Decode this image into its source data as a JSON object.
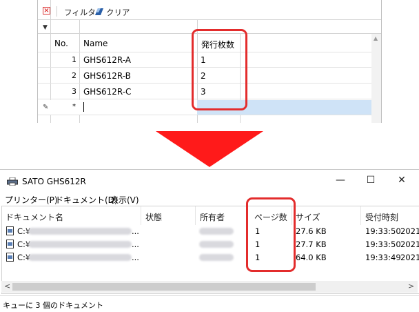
{
  "grid": {
    "toolbar": {
      "filter_label": "フィルタ",
      "clear_label": "クリア"
    },
    "columns": {
      "no": "No.",
      "name": "Name",
      "qty": "発行枚数"
    },
    "rows": [
      {
        "no": "1",
        "name": "GHS612R-A",
        "qty": "1"
      },
      {
        "no": "2",
        "name": "GHS612R-B",
        "qty": "2"
      },
      {
        "no": "3",
        "name": "GHS612R-C",
        "qty": "3"
      }
    ],
    "new_row_marker": "*"
  },
  "queue": {
    "title": "SATO GHS612R",
    "window_controls": {
      "minimize": "—",
      "maximize": "☐",
      "close": "✕"
    },
    "menu": [
      "プリンター(P)",
      "ドキュメント(D)",
      "表示(V)"
    ],
    "columns": {
      "doc": "ドキュメント名",
      "status": "状態",
      "owner": "所有者",
      "pages": "ページ数",
      "size": "サイズ",
      "received": "受付時刻"
    },
    "jobs": [
      {
        "doc": "C:¥",
        "doc_tail": "...",
        "pages": "1",
        "size": "27.6 KB",
        "time": "19:33:50",
        "date": "2021/"
      },
      {
        "doc": "C:¥",
        "doc_tail": "...",
        "pages": "1",
        "size": "27.7 KB",
        "time": "19:33:50",
        "date": "2021/"
      },
      {
        "doc": "C:¥",
        "doc_tail": "...",
        "pages": "1",
        "size": "64.0 KB",
        "time": "19:33:49",
        "date": "2021/"
      }
    ],
    "status_bar": "キューに 3 個のドキュメント"
  },
  "colors": {
    "highlight": "#e32c2c",
    "arrow": "#ff1a1a",
    "selection": "#cfe3f7"
  }
}
